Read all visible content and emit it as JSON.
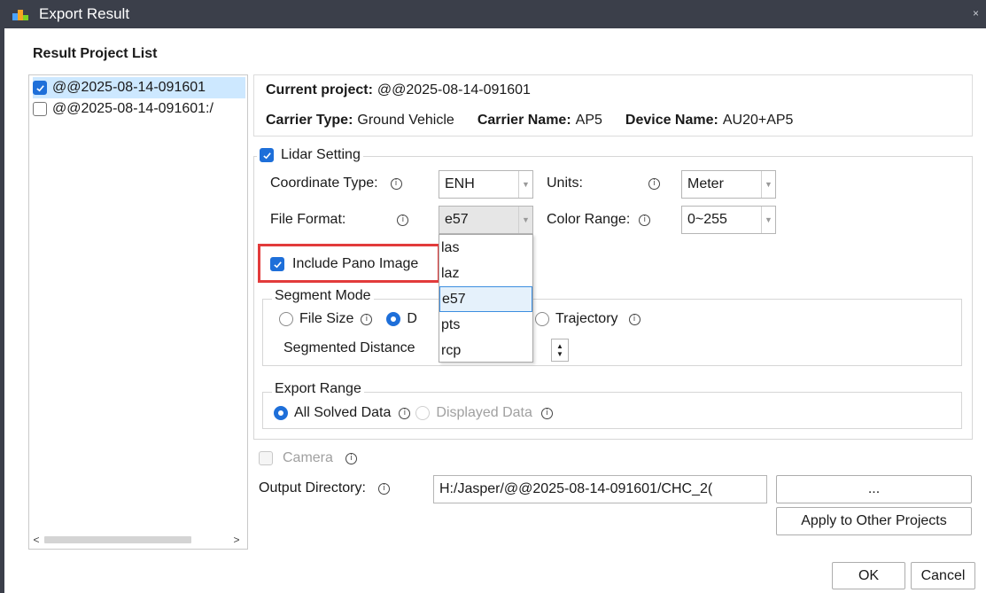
{
  "window": {
    "title": "Export Result",
    "close_glyph": "×",
    "app_icon": "app-logo-icon"
  },
  "project_list": {
    "title": "Result Project List",
    "items": [
      {
        "label": "@@2025-08-14-091601",
        "checked": true
      },
      {
        "label": "@@2025-08-14-091601:/",
        "checked": false
      }
    ]
  },
  "info": {
    "current_label": "Current project:",
    "current_value": "@@2025-08-14-091601",
    "carrier_type_label": "Carrier Type:",
    "carrier_type_value": "Ground Vehicle",
    "carrier_name_label": "Carrier Name:",
    "carrier_name_value": "AP5",
    "device_name_label": "Device Name:",
    "device_name_value": "AU20+AP5"
  },
  "lidar": {
    "title": "Lidar Setting",
    "coordinate_label": "Coordinate Type:",
    "coordinate_value": "ENH",
    "units_label": "Units:",
    "units_value": "Meter",
    "format_label": "File Format:",
    "format_value": "e57",
    "color_label": "Color Range:",
    "color_value": "0~255",
    "pano_label": "Include Pano Image",
    "format_options": [
      "las",
      "laz",
      "e57",
      "pts",
      "rcp"
    ],
    "format_selected_index": 2
  },
  "segment": {
    "title": "Segment Mode",
    "opt_filesize": "File Size",
    "opt_distance": "D",
    "opt_trajectory": "Trajectory",
    "distance_label": "Segmented Distance"
  },
  "range": {
    "title": "Export Range",
    "opt_all": "All Solved Data",
    "opt_displayed": "Displayed Data"
  },
  "camera": {
    "label": "Camera"
  },
  "output": {
    "label": "Output Directory:",
    "value": "H:/Jasper/@@2025-08-14-091601/CHC_2(",
    "browse_label": "...",
    "apply_label": "Apply to Other Projects"
  },
  "buttons": {
    "ok": "OK",
    "cancel": "Cancel"
  },
  "icons": {
    "info": "ⓘ",
    "scroll_left": "<",
    "scroll_right": ">",
    "drop": "▼",
    "spin_up": "▲",
    "spin_down": "▼"
  },
  "colors": {
    "accent": "#1e6fd9",
    "highlight": "#e23b3b",
    "titlebar": "#3b3f4a"
  }
}
